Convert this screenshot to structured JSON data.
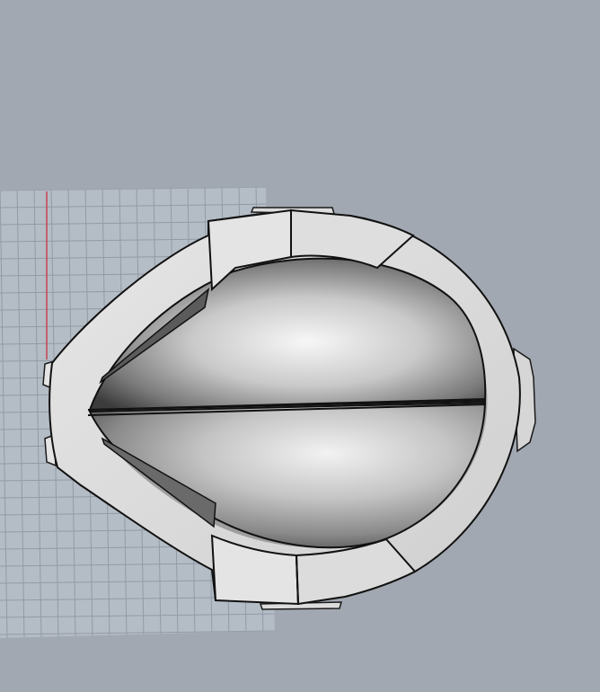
{
  "viewport": {
    "background": "#a2a8b1",
    "grid_color": "#b4bcc6",
    "grid_line_color": "#8f97a1",
    "axis_color": "#c4454f",
    "model": {
      "shell_color": "#dcdcdc",
      "edge_color": "#1a1a1a",
      "cavity_highlight": "#f4f4f4",
      "cavity_shadow": "#4a4a4a"
    }
  }
}
